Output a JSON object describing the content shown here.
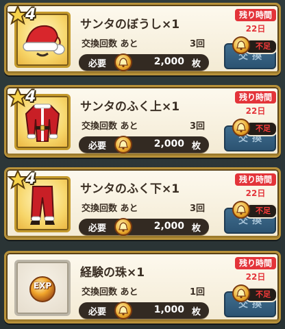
{
  "items": [
    {
      "rarity": "4",
      "icon": "santa-hat-icon",
      "name": "サンタのぼうし×1",
      "count_label": "交換回数 あと",
      "count_value": "3回",
      "cost_label": "必要",
      "cost_amount": "2,000",
      "cost_unit": "枚",
      "remain_label": "残り時間",
      "remain_value": "22日",
      "insufficient_label": "不足",
      "button_label": "交換"
    },
    {
      "rarity": "4",
      "icon": "santa-jacket-icon",
      "name": "サンタのふく上×1",
      "count_label": "交換回数 あと",
      "count_value": "3回",
      "cost_label": "必要",
      "cost_amount": "2,000",
      "cost_unit": "枚",
      "remain_label": "残り時間",
      "remain_value": "22日",
      "insufficient_label": "不足",
      "button_label": "交換"
    },
    {
      "rarity": "4",
      "icon": "santa-pants-icon",
      "name": "サンタのふく下×1",
      "count_label": "交換回数 あと",
      "count_value": "3回",
      "cost_label": "必要",
      "cost_amount": "2,000",
      "cost_unit": "枚",
      "remain_label": "残り時間",
      "remain_value": "22日",
      "insufficient_label": "不足",
      "button_label": "交換"
    },
    {
      "rarity": "",
      "icon": "exp-orb-icon",
      "icon_text": "EXP",
      "name": "経験の珠×1",
      "count_label": "交換回数 あと",
      "count_value": "1回",
      "cost_label": "必要",
      "cost_amount": "1,000",
      "cost_unit": "枚",
      "remain_label": "残り時間",
      "remain_value": "22日",
      "insufficient_label": "不足",
      "button_label": "交換"
    }
  ],
  "colors": {
    "remain_red": "#e3343a",
    "button_blue": "#3f6d8e",
    "card_gold": "#b8923a"
  }
}
